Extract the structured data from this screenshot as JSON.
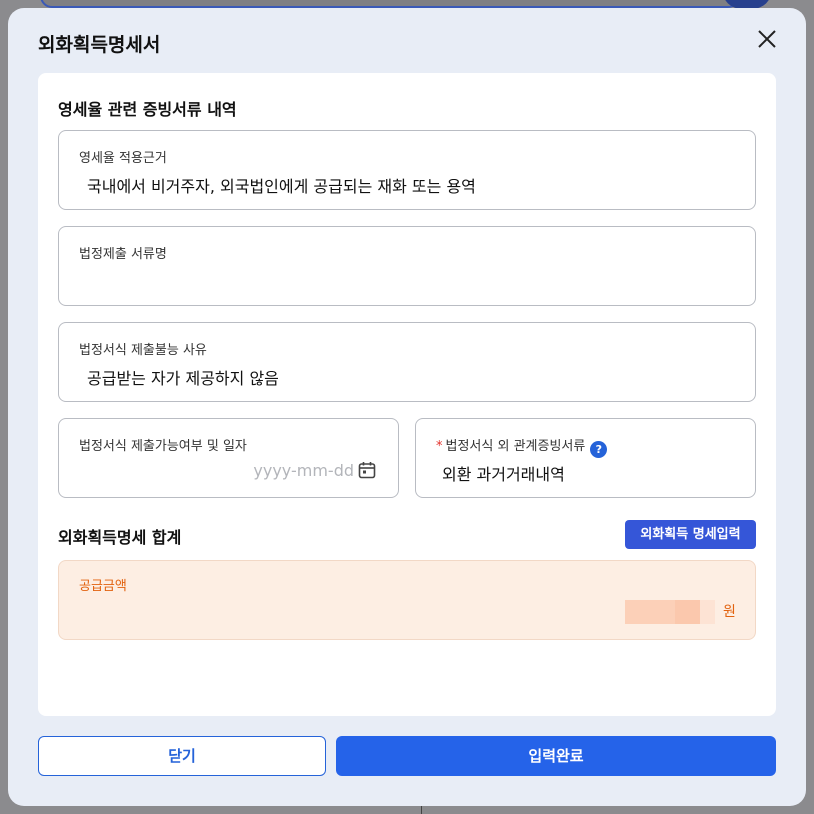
{
  "modal": {
    "title": "외화획득명세서",
    "close_icon": "close-icon"
  },
  "proof_section": {
    "title": "영세율 관련 증빙서류 내역",
    "fields": {
      "basis": {
        "label": "영세율 적용근거",
        "value": "국내에서 비거주자, 외국법인에게 공급되는 재화 또는 용역"
      },
      "legal_doc_name": {
        "label": "법정제출 서류명",
        "value": ""
      },
      "reason": {
        "label": "법정서식 제출불능 사유",
        "value": "공급받는 자가 제공하지 않음"
      },
      "availability_date": {
        "label": "법정서식 제출가능여부 및 일자",
        "placeholder": "yyyy-mm-dd",
        "icon": "calendar-icon"
      },
      "related_doc": {
        "label": "법정서식 외 관계증빙서류",
        "required_mark": "*",
        "help_icon": "?",
        "value": "외환 과거거래내역"
      }
    }
  },
  "summary_section": {
    "title": "외화획득명세 합계",
    "detail_button": "외화획득 명세입력",
    "amount_label": "공급금액",
    "amount_unit": "원"
  },
  "footer": {
    "close_label": "닫기",
    "submit_label": "입력완료"
  },
  "colors": {
    "primary": "#2563e9",
    "detail_button": "#3556d8",
    "amount_text": "#e2620f",
    "amount_bg": "#fdeee3",
    "required": "#e3302b"
  }
}
